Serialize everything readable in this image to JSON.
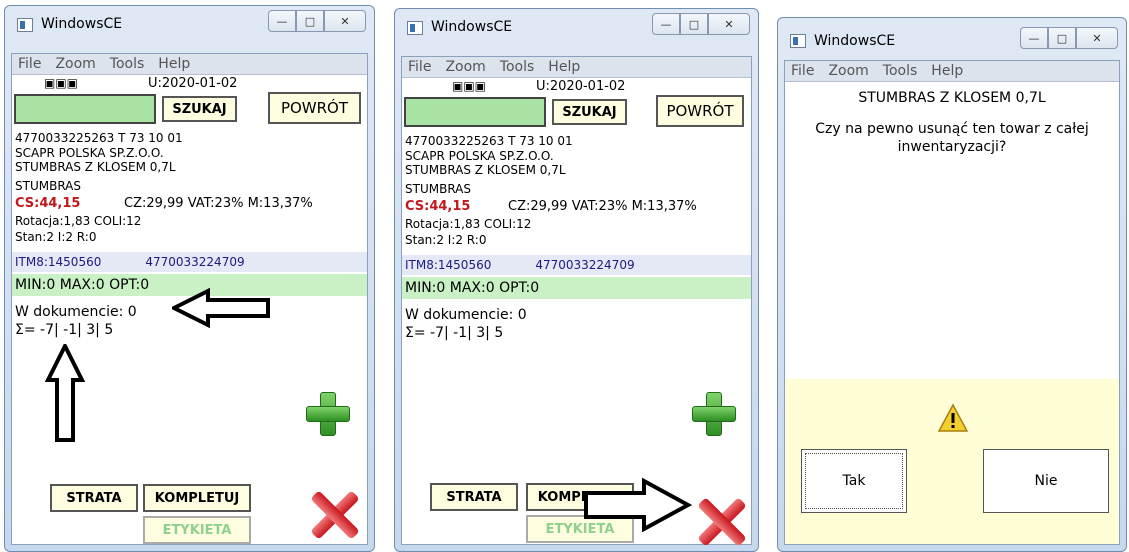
{
  "windows": [
    {
      "title": "WindowsCE",
      "menu": [
        "File",
        "Zoom",
        "Tools",
        "Help"
      ],
      "ind": "▣▣▣",
      "date": "U:2020-01-02",
      "search_label": "SZUKAJ",
      "back_label": "POWRÓT",
      "line1": "4770033225263  T  73 10 01",
      "line2": "SCAPR POLSKA SP.Z.O.O.",
      "line3": "STUMBRAS Z KLOSEM 0,7L",
      "brand": "STUMBRAS",
      "cs": "CS:44,15",
      "prices": "CZ:29,99  VAT:23%  M:13,37%",
      "rot": "Rotacja:1,83   COLI:12",
      "stan": "Stan:2  I:2  R:0",
      "itm": "ITM8:1450560",
      "ean": "4770033224709",
      "minmax": "MIN:0 MAX:0 OPT:0",
      "doc": "W dokumencie: 0",
      "sum": "Σ= -7| -1| 3| 5",
      "strata": "STRATA",
      "kompletuj": "KOMPLETUJ",
      "etykieta": "ETYKIETA"
    },
    {
      "title": "WindowsCE",
      "menu": [
        "File",
        "Zoom",
        "Tools",
        "Help"
      ],
      "ind": "▣▣▣",
      "date": "U:2020-01-02",
      "search_label": "SZUKAJ",
      "back_label": "POWRÓT",
      "line1": "4770033225263  T  73 10 01",
      "line2": "SCAPR POLSKA SP.Z.O.O.",
      "line3": "STUMBRAS Z KLOSEM 0,7L",
      "brand": "STUMBRAS",
      "cs": "CS:44,15",
      "prices": "CZ:29,99  VAT:23%  M:13,37%",
      "rot": "Rotacja:1,83   COLI:12",
      "stan": "Stan:2  I:2  R:0",
      "itm": "ITM8:1450560",
      "ean": "4770033224709",
      "minmax": "MIN:0 MAX:0 OPT:0",
      "doc": "W dokumencie: 0",
      "sum": "Σ= -7| -1| 3| 5",
      "strata": "STRATA",
      "kompletuj": "KOMPLETUJ",
      "etykieta": "ETYKIETA"
    }
  ],
  "dialog": {
    "title": "WindowsCE",
    "menu": [
      "File",
      "Zoom",
      "Tools",
      "Help"
    ],
    "product": "STUMBRAS Z KLOSEM 0,7L",
    "question": "Czy na pewno usunąć ten towar z całej inwentaryzacji?",
    "yes": "Tak",
    "no": "Nie"
  }
}
